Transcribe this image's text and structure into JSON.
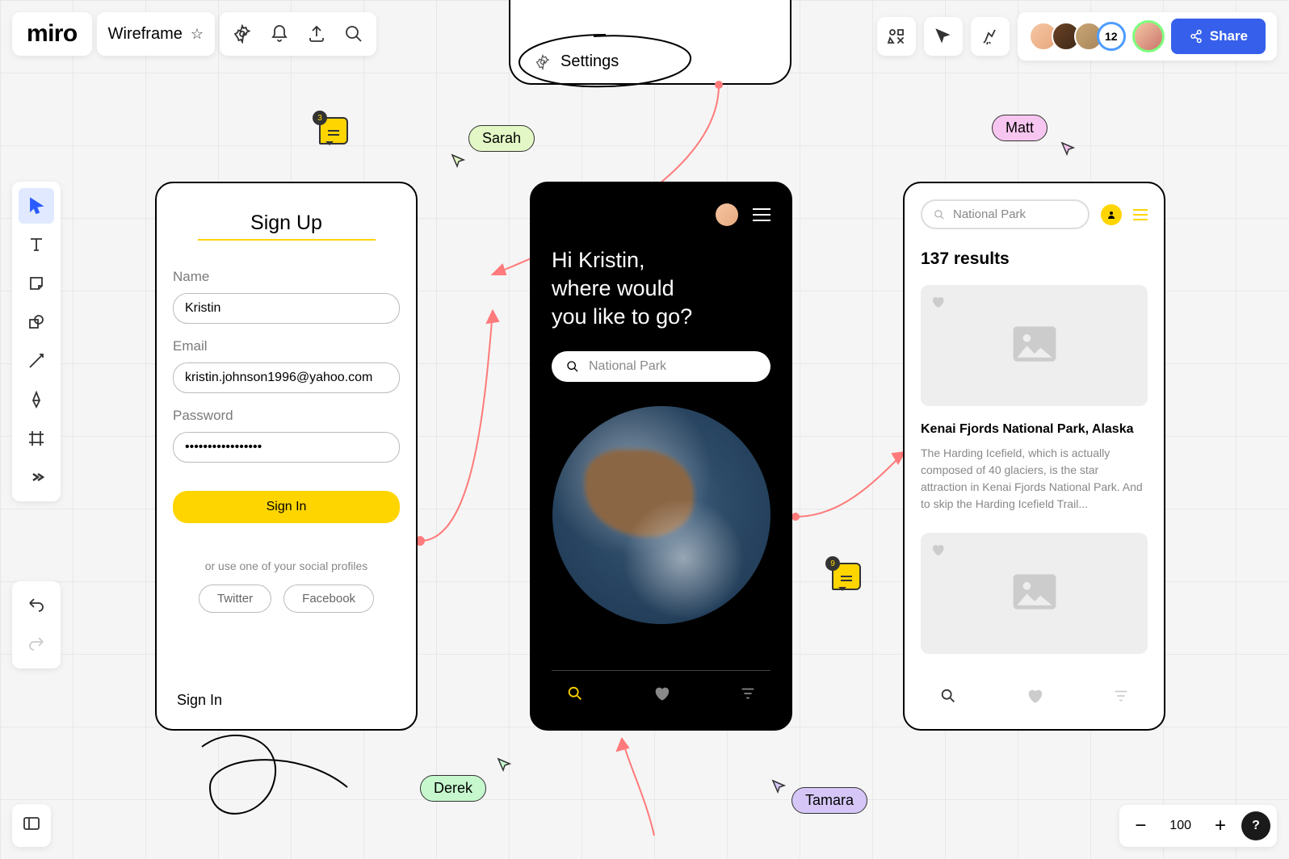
{
  "app": {
    "name": "miro",
    "board_name": "Wireframe"
  },
  "header_icons": {
    "star": "star-icon",
    "settings": "settings-gear-icon",
    "notifications": "bell-icon",
    "export": "export-icon",
    "search": "search-icon"
  },
  "top_right": {
    "cursor_tool": "cursor-icon",
    "reactions": "party-icon",
    "shapes": "shapes-icon",
    "user_count": "12",
    "share_label": "Share"
  },
  "left_tools": [
    "select",
    "text",
    "sticky",
    "shapes",
    "connector",
    "pen",
    "frame",
    "more"
  ],
  "zoom": {
    "value": "100",
    "help": "?"
  },
  "settings_tab": {
    "label": "Settings"
  },
  "phone1": {
    "title": "Sign Up",
    "labels": {
      "name": "Name",
      "email": "Email",
      "password": "Password"
    },
    "values": {
      "name": "Kristin",
      "email": "kristin.johnson1996@yahoo.com",
      "password": "•••••••••••••••••"
    },
    "submit": "Sign In",
    "social_hint": "or use one of your social profiles",
    "twitter": "Twitter",
    "facebook": "Facebook",
    "signin_link": "Sign In"
  },
  "phone2": {
    "greeting_line1": "Hi Kristin,",
    "greeting_line2": "where would",
    "greeting_line3": "you like to go?",
    "search_placeholder": "National Park"
  },
  "phone3": {
    "search_value": "National Park",
    "results": "137 results",
    "card_title": "Kenai Fjords National Park, Alaska",
    "card_desc": "The Harding Icefield, which is actually composed of 40 glaciers, is the star attraction in Kenai Fjords National Park. And to skip the Harding Icefield Trail..."
  },
  "cursors": {
    "sarah": "Sarah",
    "matt": "Matt",
    "derek": "Derek",
    "tamara": "Tamara"
  },
  "comments": {
    "c1": "3",
    "c2": "9"
  }
}
